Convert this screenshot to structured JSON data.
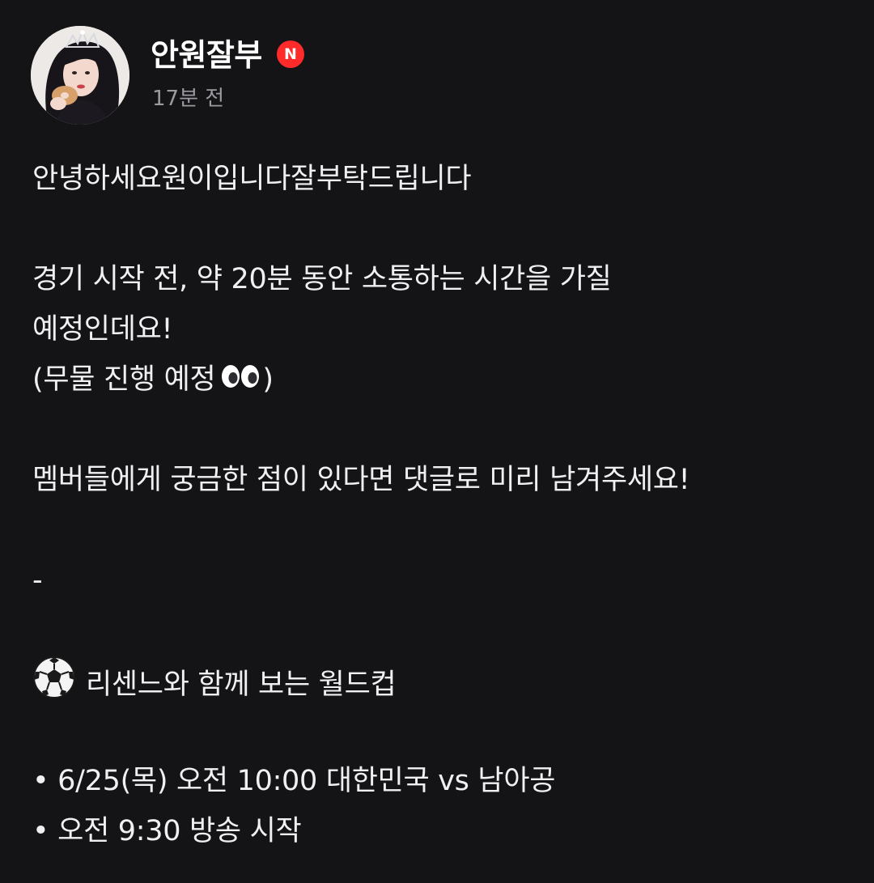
{
  "post": {
    "author": "안원잘부",
    "badge": "N",
    "time": "17분 전",
    "lines": [
      "안녕하세요원이입니다잘부탁드립니다",
      "경기 시작 전, 약 20분 동안 소통하는 시간을 가질",
      "예정인데요!",
      "(무물 진행 예정",
      ")",
      "멤버들에게 궁금한 점이 있다면 댓글로 미리 남겨주세요!",
      "-",
      "리센느와 함께 보는 월드컵",
      "• 6/25(목) 오전 10:00 대한민국 vs 남아공",
      "• 오전 9:30 방송 시작"
    ]
  },
  "icons": {
    "eyes": "eyes-emoji-icon",
    "soccer": "soccer-ball-emoji-icon"
  },
  "colors": {
    "background": "#141416",
    "text": "#f0f0f2",
    "muted": "#9a9aa0",
    "badge": "#ff2b2b"
  }
}
